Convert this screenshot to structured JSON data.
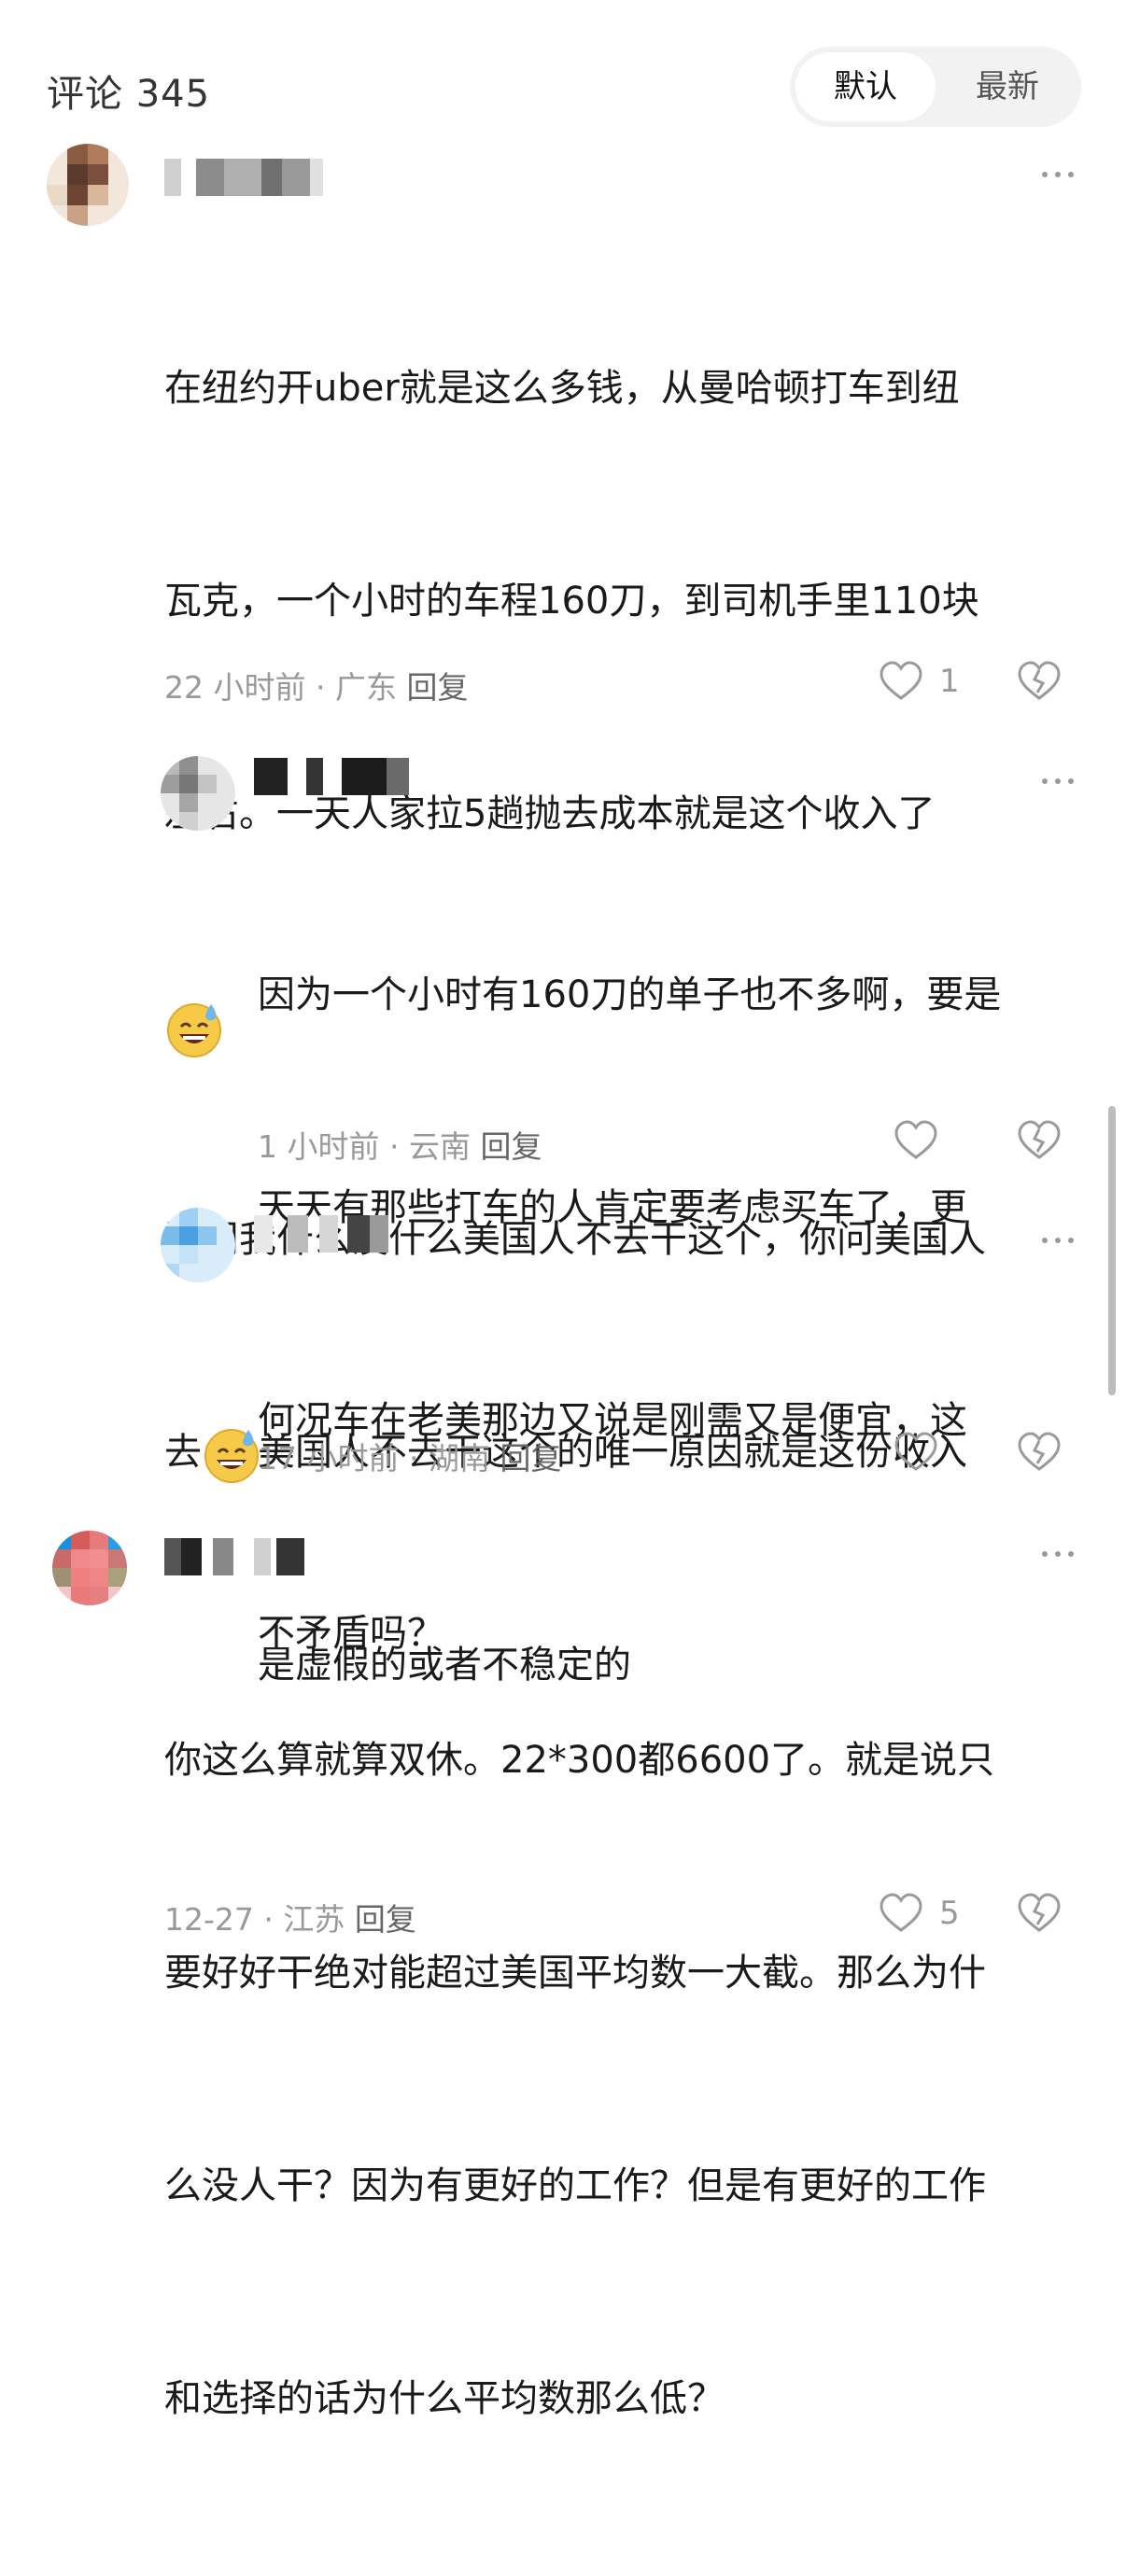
{
  "header": {
    "title": "评论 345",
    "sort": {
      "default_label": "默认",
      "latest_label": "最新",
      "active": "默认"
    }
  },
  "comments": [
    {
      "username": "",
      "text_lines": [
        "在纽约开uber就是这么多钱，从曼哈顿打车到纽",
        "瓦克，一个小时的车程160刀，到司机手里110块",
        "左右。一天人家拉5趟抛去成本就是这个收入了"
      ],
      "emoji": "sweat-smile-emoji",
      "text_lines_2": [
        "别问我什么没什么美国人不去干这个，你问美国人",
        "去"
      ],
      "time": "22 小时前",
      "location": "广东",
      "reply_label": "回复",
      "likes": "1"
    },
    {
      "username": "",
      "text_lines": [
        "因为一个小时有160刀的单子也不多啊，要是",
        "天天有那些打车的人肯定要考虑买车了，更",
        "何况车在老美那边又说是刚需又是便宜，这",
        "不矛盾吗？"
      ],
      "time": "1 小时前",
      "location": "云南",
      "reply_label": "回复",
      "likes": ""
    },
    {
      "username": "",
      "text_lines": [
        "美国人不去干这个的唯一原因就是这份收入",
        "是虚假的或者不稳定的"
      ],
      "time": "17 小时前",
      "location": "湖南",
      "reply_label": "回复",
      "likes": ""
    },
    {
      "username": "",
      "text_lines": [
        "你这么算就算双休。22*300都6600了。就是说只",
        "要好好干绝对能超过美国平均数一大截。那么为什",
        "么没人干？因为有更好的工作？但是有更好的工作",
        "和选择的话为什么平均数那么低？"
      ],
      "time": "12-27",
      "location": "江苏",
      "reply_label": "回复",
      "likes": "5"
    }
  ],
  "colors": {
    "text": "#1a1a1a",
    "meta": "#999999",
    "toggle_bg": "#f2f2f2"
  }
}
